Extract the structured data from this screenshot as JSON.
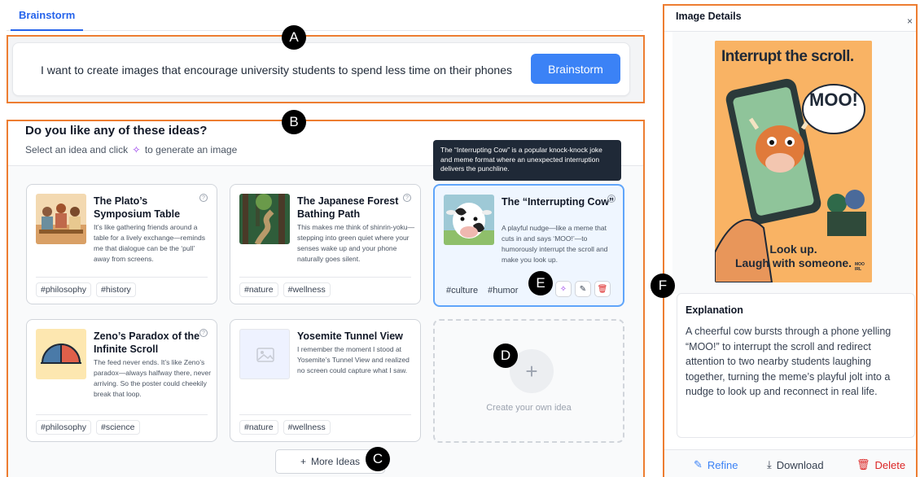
{
  "tab": {
    "label": "Brainstorm"
  },
  "prompt": {
    "text": "I want to create images that encourage university students to spend less time on their phones",
    "button_label": "Brainstorm"
  },
  "ideas": {
    "heading": "Do you like any of these ideas?",
    "sub_before": "Select an idea and click",
    "sub_after": "to generate an image",
    "cards": [
      {
        "title": "The Plato’s Symposium Table",
        "desc": "It’s like gathering friends around a table for a lively exchange—reminds me that dialogue can be the ‘pull’ away from screens.",
        "tags": [
          "#philosophy",
          "#history"
        ]
      },
      {
        "title": "The Japanese Forest Bathing Path",
        "desc": "This makes me think of shinrin-yoku—stepping into green quiet where your senses wake up and your phone naturally goes silent.",
        "tags": [
          "#nature",
          "#wellness"
        ]
      },
      {
        "title": "The “Interrupting Cow”",
        "desc": "A playful nudge—like a meme that cuts in and says ‘MOO!’—to humorously interrupt the scroll and make you look up.",
        "tags": [
          "#culture",
          "#humor"
        ]
      },
      {
        "title": "Zeno’s Paradox of the Infinite Scroll",
        "desc": "The feed never ends. It’s like Zeno’s paradox—always halfway there, never arriving. So the poster could cheekily break that loop.",
        "tags": [
          "#philosophy",
          "#science"
        ]
      },
      {
        "title": "Yosemite Tunnel View",
        "desc": "I remember the moment I stood at Yosemite’s Tunnel View and realized no screen could capture what I saw.",
        "tags": [
          "#nature",
          "#wellness"
        ]
      }
    ],
    "create_label": "Create your own idea",
    "more_label": "More Ideas",
    "tooltip": "The “Interrupting Cow” is a popular knock-knock joke and meme format where an unexpected interruption delivers the punchline."
  },
  "callouts": {
    "a": "A",
    "b": "B",
    "c": "C",
    "d": "D",
    "e": "E",
    "f": "F"
  },
  "details": {
    "title": "Image Details",
    "close": "×",
    "poster_top": "Interrupt the scroll.",
    "poster_moo": "MOO!",
    "poster_bottom1": "Look up.",
    "poster_bottom2": "Laugh with someone.",
    "poster_mark1": "MOO",
    "poster_mark2": "IRL",
    "expl_title": "Explanation",
    "expl_text": "A cheerful cow bursts through a phone yelling “MOO!” to interrupt the scroll and redirect attention to two nearby students laughing together, turning the meme’s playful jolt into a nudge to look up and reconnect in real life.",
    "refine": "Refine",
    "download": "Download",
    "delete": "Delete"
  },
  "colors": {
    "accent": "#3b82f6",
    "callout_border": "#ed7d31",
    "delete": "#dc2626"
  }
}
